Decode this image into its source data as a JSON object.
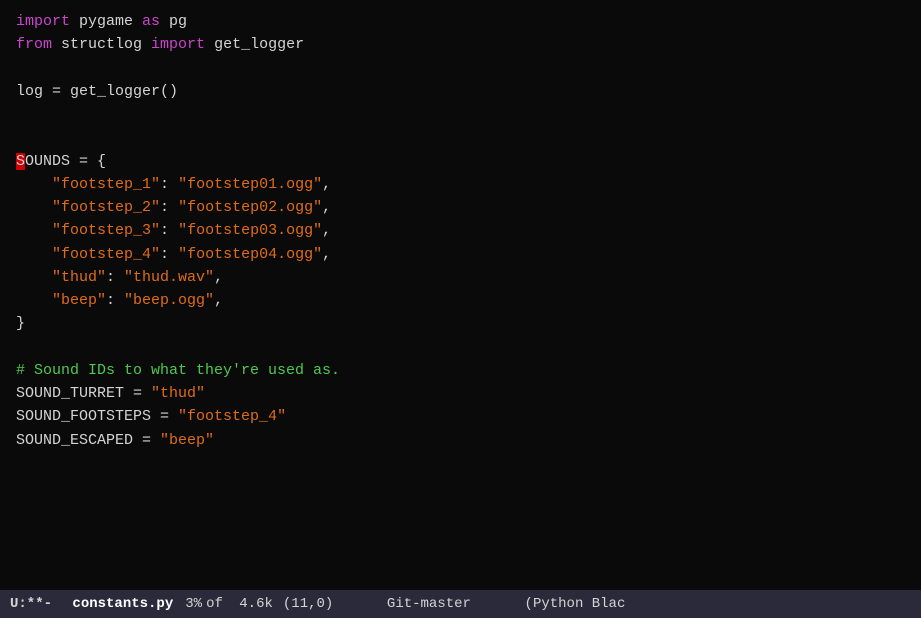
{
  "editor": {
    "lines": [
      {
        "id": "line1",
        "tokens": [
          {
            "text": "import",
            "cls": "kw"
          },
          {
            "text": " pygame ",
            "cls": "var"
          },
          {
            "text": "as",
            "cls": "kw"
          },
          {
            "text": " pg",
            "cls": "var"
          }
        ]
      },
      {
        "id": "line2",
        "tokens": [
          {
            "text": "from",
            "cls": "kw"
          },
          {
            "text": " structlog ",
            "cls": "var"
          },
          {
            "text": "import",
            "cls": "kw"
          },
          {
            "text": " get_logger",
            "cls": "var"
          }
        ]
      },
      {
        "id": "line3",
        "tokens": []
      },
      {
        "id": "line4",
        "tokens": [
          {
            "text": "log",
            "cls": "var"
          },
          {
            "text": " = ",
            "cls": "op"
          },
          {
            "text": "get_logger()",
            "cls": "var"
          }
        ]
      },
      {
        "id": "line5",
        "tokens": []
      },
      {
        "id": "line6",
        "tokens": []
      },
      {
        "id": "line6b",
        "tokens": [
          {
            "text": "S",
            "cls": "highlight-s"
          },
          {
            "text": "OUNDS",
            "cls": "var"
          },
          {
            "text": " = {",
            "cls": "op"
          }
        ]
      },
      {
        "id": "line7",
        "tokens": [
          {
            "text": "    ",
            "cls": "var"
          },
          {
            "text": "\"footstep_1\"",
            "cls": "key"
          },
          {
            "text": ": ",
            "cls": "op"
          },
          {
            "text": "\"footstep01.ogg\"",
            "cls": "str"
          },
          {
            "text": ",",
            "cls": "op"
          }
        ]
      },
      {
        "id": "line8",
        "tokens": [
          {
            "text": "    ",
            "cls": "var"
          },
          {
            "text": "\"footstep_2\"",
            "cls": "key"
          },
          {
            "text": ": ",
            "cls": "op"
          },
          {
            "text": "\"footstep02.ogg\"",
            "cls": "str"
          },
          {
            "text": ",",
            "cls": "op"
          }
        ]
      },
      {
        "id": "line9",
        "tokens": [
          {
            "text": "    ",
            "cls": "var"
          },
          {
            "text": "\"footstep_3\"",
            "cls": "key"
          },
          {
            "text": ": ",
            "cls": "op"
          },
          {
            "text": "\"footstep03.ogg\"",
            "cls": "str"
          },
          {
            "text": ",",
            "cls": "op"
          }
        ]
      },
      {
        "id": "line10",
        "tokens": [
          {
            "text": "    ",
            "cls": "var"
          },
          {
            "text": "\"footstep_4\"",
            "cls": "key"
          },
          {
            "text": ": ",
            "cls": "op"
          },
          {
            "text": "\"footstep04.ogg\"",
            "cls": "str"
          },
          {
            "text": ",",
            "cls": "op"
          }
        ]
      },
      {
        "id": "line11",
        "tokens": [
          {
            "text": "    ",
            "cls": "var"
          },
          {
            "text": "\"thud\"",
            "cls": "key"
          },
          {
            "text": ": ",
            "cls": "op"
          },
          {
            "text": "\"thud.wav\"",
            "cls": "str"
          },
          {
            "text": ",",
            "cls": "op"
          }
        ]
      },
      {
        "id": "line12",
        "tokens": [
          {
            "text": "    ",
            "cls": "var"
          },
          {
            "text": "\"beep\"",
            "cls": "key"
          },
          {
            "text": ": ",
            "cls": "op"
          },
          {
            "text": "\"beep.ogg\"",
            "cls": "str"
          },
          {
            "text": ",",
            "cls": "op"
          }
        ]
      },
      {
        "id": "line13",
        "tokens": [
          {
            "text": "}",
            "cls": "op"
          }
        ]
      },
      {
        "id": "line14",
        "tokens": []
      },
      {
        "id": "line15",
        "tokens": [
          {
            "text": "# Sound IDs to what they're used as.",
            "cls": "comment"
          }
        ]
      },
      {
        "id": "line16",
        "tokens": [
          {
            "text": "SOUND_TURRET",
            "cls": "var"
          },
          {
            "text": " = ",
            "cls": "op"
          },
          {
            "text": "\"thud\"",
            "cls": "str"
          }
        ]
      },
      {
        "id": "line17",
        "tokens": [
          {
            "text": "SOUND_FOOTSTEPS",
            "cls": "var"
          },
          {
            "text": " = ",
            "cls": "op"
          },
          {
            "text": "\"footstep_4\"",
            "cls": "str"
          }
        ]
      },
      {
        "id": "line18",
        "tokens": [
          {
            "text": "SOUND_ESCAPED",
            "cls": "var"
          },
          {
            "text": " = ",
            "cls": "op"
          },
          {
            "text": "\"beep\"",
            "cls": "str"
          }
        ]
      }
    ]
  },
  "statusbar": {
    "mode": "U:**-",
    "filename": "constants.py",
    "pct": "3%",
    "of_label": "of",
    "size": "4.6k",
    "pos": "(11,0)",
    "git": "Git-master",
    "syntax": "(Python Blac"
  }
}
